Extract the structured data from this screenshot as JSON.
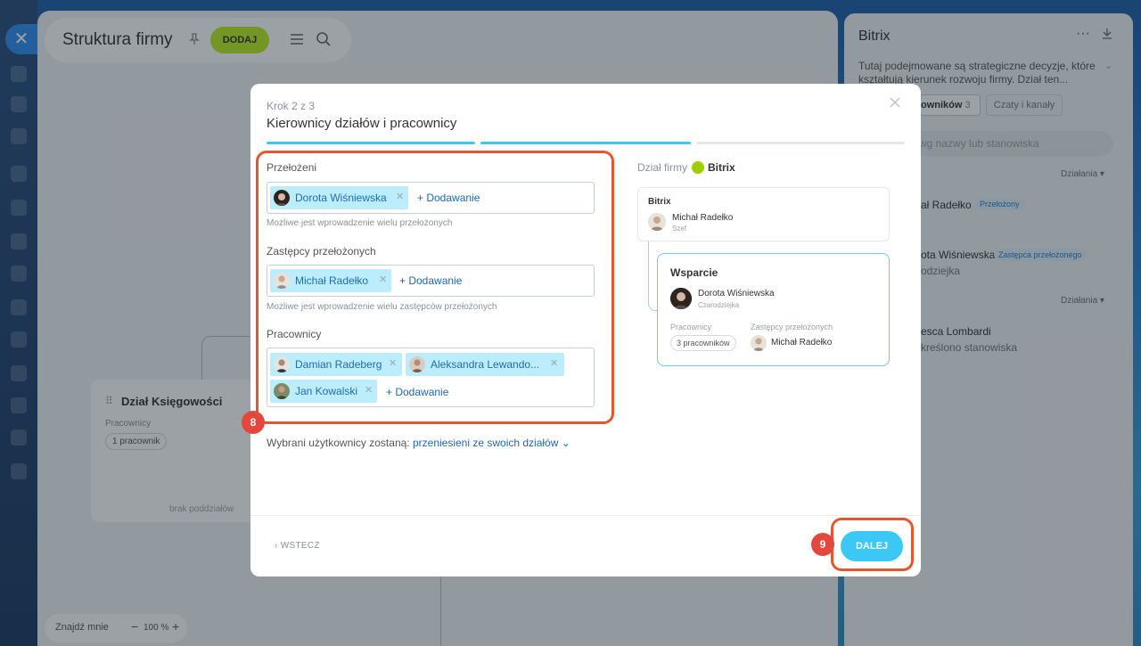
{
  "main": {
    "title": "Struktura firmy",
    "add_label": "DODAJ",
    "dept_card": {
      "title": "Dział Księgowości",
      "employees_label": "Pracownicy",
      "employees_count": "1 pracownik",
      "no_subdepts": "brak poddziałów"
    },
    "zoom": {
      "find_me": "Znajdź mnie",
      "minus": "−",
      "value": "100 %",
      "plus": "+"
    }
  },
  "side_panel": {
    "title": "Bitrix",
    "more": "···",
    "description": "Tutaj podejmowane są strategiczne decyzje, które kształtują kierunek rozwoju firmy. Dział ten...",
    "tab_employees": "owników",
    "tab_employees_count": "3",
    "tab_chats": "Czaty i kanały",
    "search_placeholder": "wg nazwy lub stanowiska",
    "actions_label": "Działania ▾",
    "people": [
      {
        "name": "ał Radełko",
        "badge": "Przełożony",
        "role": ""
      },
      {
        "name": "ota Wiśniewska",
        "badge": "Zastępca przełożonego",
        "role": "odziejka"
      },
      {
        "name": "esca Lombardi",
        "badge": "",
        "role": "kreślono stanowiska"
      }
    ]
  },
  "modal": {
    "step": "Krok 2 z 3",
    "title": "Kierownicy działów i pracownicy",
    "progress": [
      1,
      1,
      0
    ],
    "heads": {
      "label": "Przełożeni",
      "chips": [
        {
          "name": "Dorota Wiśniewska"
        }
      ],
      "add": "+ Dodawanie",
      "hint": "Możliwe jest wprowadzenie wielu przełożonych"
    },
    "deputies": {
      "label": "Zastępcy przełożonych",
      "chips": [
        {
          "name": "Michał Radełko"
        }
      ],
      "add": "+ Dodawanie",
      "hint": "Możliwe jest wprowadzenie wielu zastępców przełożonych"
    },
    "employees": {
      "label": "Pracownicy",
      "chips": [
        {
          "name": "Damian Radeberg"
        },
        {
          "name": "Aleksandra Lewando..."
        },
        {
          "name": "Jan Kowalski"
        }
      ],
      "add": "+ Dodawanie"
    },
    "move_note_prefix": "Wybrani użytkownicy zostaną:",
    "move_note_link": "przeniesieni ze swoich działów",
    "preview": {
      "firm_label": "Dział firmy",
      "firm_name": "Bitrix",
      "parent": {
        "title": "Bitrix",
        "person": "Michał Radełko",
        "role": "Szef"
      },
      "child": {
        "title": "Wsparcie",
        "person": "Dorota Wiśniewska",
        "role": "Czarodziejka",
        "employees_label": "Pracownicy",
        "deputies_label": "Zastępcy przełożonych",
        "employees_count": "3 pracowników",
        "deputy": "Michał Radełko"
      }
    },
    "back_label": "WSTECZ",
    "next_label": "DALEJ"
  },
  "annotations": {
    "box1": "8",
    "box2": "9",
    "color": "#e4572e"
  },
  "colors": {
    "accent": "#3bc8f5",
    "chip": "#bcedfc",
    "link": "#2067b0",
    "add_btn": "#bbed21"
  }
}
